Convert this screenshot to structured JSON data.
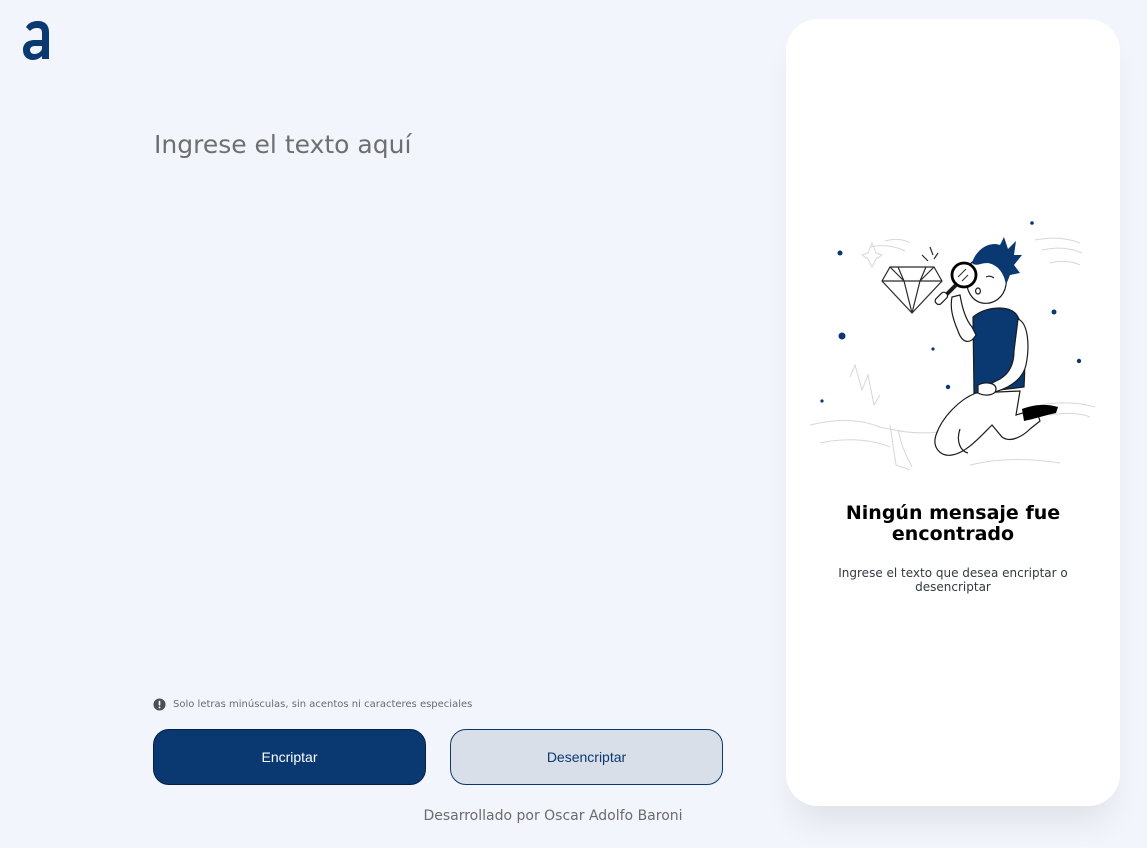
{
  "input": {
    "placeholder": "Ingrese el texto aquí"
  },
  "hint": {
    "icon": "exclamation-circle-icon",
    "text": "Solo letras minúsculas, sin acentos ni caracteres especiales"
  },
  "buttons": {
    "encrypt_label": "Encriptar",
    "decrypt_label": "Desencriptar"
  },
  "footer": {
    "text": "Desarrollado por Oscar Adolfo Baroni"
  },
  "output_panel": {
    "title": "Ningún mensaje fue encontrado",
    "subtitle": "Ingrese el texto que desea encriptar o desencriptar",
    "illustration": "person-with-magnifying-glass-and-diamond"
  },
  "colors": {
    "primary": "#0a3871",
    "background": "#f3f5fc",
    "panel": "#ffffff",
    "secondary_button": "#d8dfe8"
  }
}
